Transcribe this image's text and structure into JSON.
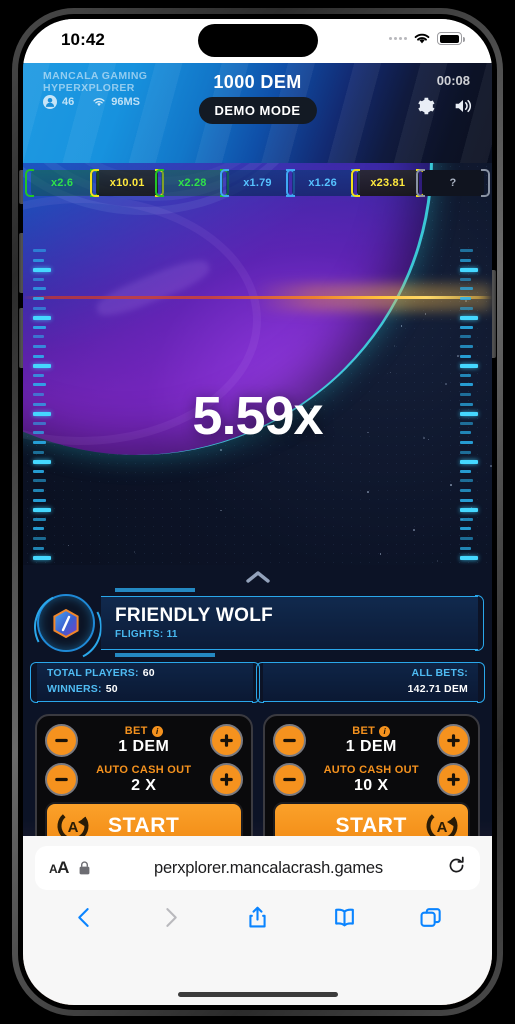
{
  "status_bar": {
    "time": "10:42",
    "wifi_icon": "wifi-icon",
    "battery_icon": "battery-icon"
  },
  "game": {
    "brand_line1": "MANCALA GAMING",
    "brand_line2": "HYPERXPLORER",
    "players_online": "46",
    "ping": "96MS",
    "balance": "1000 DEM",
    "demo_mode": "DEMO MODE",
    "clock": "00:08",
    "settings_icon": "gear-icon",
    "sound_icon": "speaker-icon",
    "multiplier": "5.59x",
    "history": [
      {
        "label": "x2.6",
        "color": "green"
      },
      {
        "label": "x10.01",
        "color": "yellow"
      },
      {
        "label": "x2.28",
        "color": "green"
      },
      {
        "label": "x1.79",
        "color": "blue"
      },
      {
        "label": "x1.26",
        "color": "blue"
      },
      {
        "label": "x23.81",
        "color": "yellow"
      },
      {
        "label": "?",
        "color": "gray"
      }
    ],
    "accent_orange": "#f5921e",
    "accent_cyan": "#2aa7ea"
  },
  "player": {
    "name": "FRIENDLY WOLF",
    "flights_label": "FLIGHTS:",
    "flights_value": "11"
  },
  "stats": {
    "total_players_label": "TOTAL PLAYERS:",
    "total_players_value": "60",
    "winners_label": "WINNERS:",
    "winners_value": "50",
    "all_bets_label": "ALL BETS:",
    "all_bets_value": "142.71 DEM"
  },
  "bet_panels": [
    {
      "bet_label": "BET",
      "bet_value": "1 DEM",
      "auto_cashout_label": "AUTO CASH OUT",
      "auto_cashout_value": "2 X",
      "start_label": "START",
      "auto_icon_side": "left",
      "minus": "−",
      "plus": "+"
    },
    {
      "bet_label": "BET",
      "bet_value": "1 DEM",
      "auto_cashout_label": "AUTO CASH OUT",
      "auto_cashout_value": "10 X",
      "start_label": "START",
      "auto_icon_side": "right",
      "minus": "−",
      "plus": "+"
    }
  ],
  "browser": {
    "aa_small": "A",
    "aa_big": "A",
    "lock_icon": "lock-icon",
    "url": "perxplorer.mancalacrash.games",
    "reload_icon": "reload-icon",
    "toolbar": [
      {
        "name": "back-button",
        "icon": "chevron-left-icon"
      },
      {
        "name": "forward-button",
        "icon": "chevron-right-icon"
      },
      {
        "name": "share-button",
        "icon": "share-icon"
      },
      {
        "name": "bookmarks-button",
        "icon": "book-icon"
      },
      {
        "name": "tabs-button",
        "icon": "tabs-icon"
      }
    ]
  }
}
